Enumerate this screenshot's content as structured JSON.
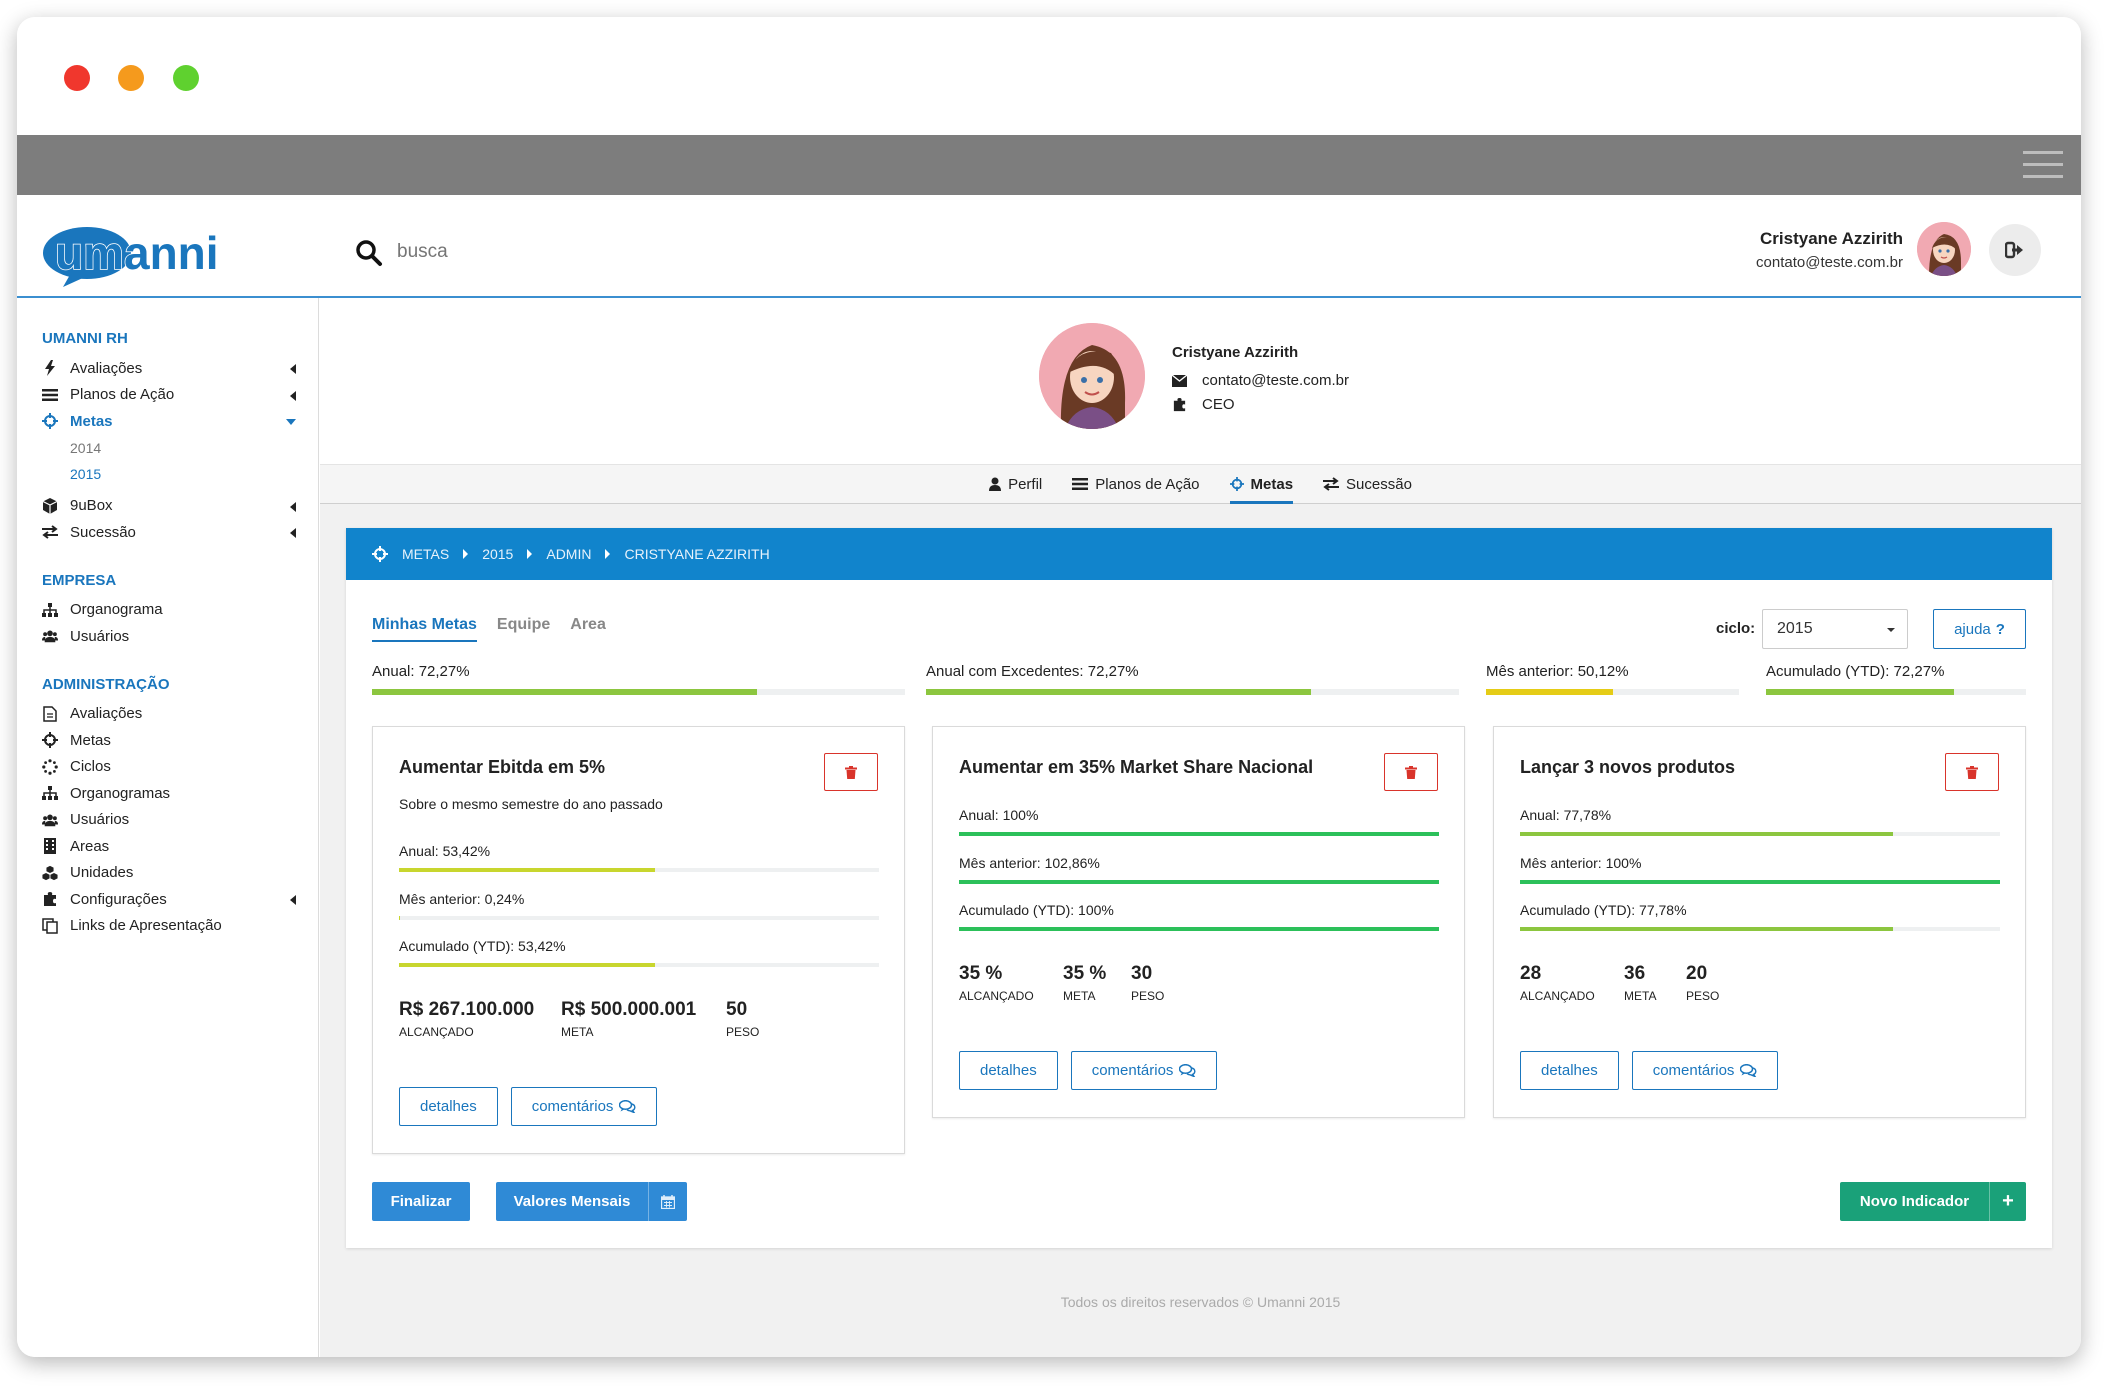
{
  "app": {
    "logo_text": "umanni",
    "search_placeholder": "busca"
  },
  "user": {
    "name": "Cristyane Azzirith",
    "email": "contato@teste.com.br",
    "role": "CEO"
  },
  "sidebar": {
    "sections": [
      {
        "title": "UMANNI RH",
        "items": [
          {
            "label": "Avaliações",
            "icon": "bolt-icon",
            "has_arrow": true
          },
          {
            "label": "Planos de Ação",
            "icon": "list-icon",
            "has_arrow": true
          },
          {
            "label": "Metas",
            "icon": "crosshair-icon",
            "active": true,
            "expanded": true,
            "subitems": [
              {
                "label": "2014"
              },
              {
                "label": "2015",
                "active": true
              }
            ]
          },
          {
            "label": "9uBox",
            "icon": "cube-icon",
            "has_arrow": true
          },
          {
            "label": "Sucessão",
            "icon": "exchange-icon",
            "has_arrow": true
          }
        ]
      },
      {
        "title": "EMPRESA",
        "items": [
          {
            "label": "Organograma",
            "icon": "sitemap-icon"
          },
          {
            "label": "Usuários",
            "icon": "users-icon"
          }
        ]
      },
      {
        "title": "ADMINISTRAÇÃO",
        "items": [
          {
            "label": "Avaliações",
            "icon": "file-icon"
          },
          {
            "label": "Metas",
            "icon": "crosshair-icon"
          },
          {
            "label": "Ciclos",
            "icon": "spinner-icon"
          },
          {
            "label": "Organogramas",
            "icon": "sitemap-icon"
          },
          {
            "label": "Usuários",
            "icon": "users-icon"
          },
          {
            "label": "Areas",
            "icon": "building-icon"
          },
          {
            "label": "Unidades",
            "icon": "cubes-icon"
          },
          {
            "label": "Configurações",
            "icon": "puzzle-icon",
            "has_arrow": true
          },
          {
            "label": "Links de Apresentação",
            "icon": "copy-icon"
          }
        ]
      }
    ]
  },
  "profile_tabs": [
    {
      "label": "Perfil",
      "icon": "user-icon"
    },
    {
      "label": "Planos de Ação",
      "icon": "list-icon"
    },
    {
      "label": "Metas",
      "icon": "crosshair-icon",
      "active": true
    },
    {
      "label": "Sucessão",
      "icon": "exchange-icon"
    }
  ],
  "breadcrumb": [
    "METAS",
    "2015",
    "ADMIN",
    "CRISTYANE AZZIRITH"
  ],
  "subtabs": [
    {
      "label": "Minhas Metas",
      "active": true
    },
    {
      "label": "Equipe"
    },
    {
      "label": "Area"
    }
  ],
  "ciclo": {
    "label": "ciclo:",
    "value": "2015"
  },
  "help_label": "ajuda",
  "summary": [
    {
      "label": "Anual: 72,27%",
      "percent": 72.27,
      "color": "#8cc63f"
    },
    {
      "label": "Anual com Excedentes: 72,27%",
      "percent": 72.27,
      "color": "#8cc63f"
    },
    {
      "label": "Mês anterior: 50,12%",
      "percent": 50.12,
      "color": "#e5cc16"
    },
    {
      "label": "Acumulado (YTD): 72,27%",
      "percent": 72.27,
      "color": "#8cc63f"
    }
  ],
  "cards": [
    {
      "title": "Aumentar Ebitda em 5%",
      "subtitle": "Sobre o mesmo semestre do ano passado",
      "metrics": [
        {
          "label": "Anual: 53,42%",
          "percent": 53.42,
          "color": "#c8d62e"
        },
        {
          "label": "Mês anterior: 0,24%",
          "percent": 0.24,
          "color": "#c8d62e"
        },
        {
          "label": "Acumulado (YTD): 53,42%",
          "percent": 53.42,
          "color": "#c8d62e"
        }
      ],
      "stats": [
        {
          "value": "R$ 267.100.000",
          "caption": "ALCANÇADO"
        },
        {
          "value": "R$ 500.000.001",
          "caption": "META"
        },
        {
          "value": "50",
          "caption": "PESO"
        }
      ],
      "details_label": "detalhes",
      "comments_label": "comentários"
    },
    {
      "title": "Aumentar em 35% Market Share Nacional",
      "subtitle": "",
      "metrics": [
        {
          "label": "Anual: 100%",
          "percent": 100,
          "color": "#2cc05a"
        },
        {
          "label": "Mês anterior: 102,86%",
          "percent": 100,
          "color": "#2cc05a"
        },
        {
          "label": "Acumulado (YTD): 100%",
          "percent": 100,
          "color": "#2cc05a"
        }
      ],
      "stats": [
        {
          "value": "35 %",
          "caption": "ALCANÇADO"
        },
        {
          "value": "35 %",
          "caption": "META"
        },
        {
          "value": "30",
          "caption": "PESO"
        }
      ],
      "details_label": "detalhes",
      "comments_label": "comentários"
    },
    {
      "title": "Lançar 3 novos produtos",
      "subtitle": "",
      "metrics": [
        {
          "label": "Anual: 77,78%",
          "percent": 77.78,
          "color": "#8cc63f"
        },
        {
          "label": "Mês anterior: 100%",
          "percent": 100,
          "color": "#2cc05a"
        },
        {
          "label": "Acumulado (YTD): 77,78%",
          "percent": 77.78,
          "color": "#8cc63f"
        }
      ],
      "stats": [
        {
          "value": "28",
          "caption": "ALCANÇADO"
        },
        {
          "value": "36",
          "caption": "META"
        },
        {
          "value": "20",
          "caption": "PESO"
        }
      ],
      "details_label": "detalhes",
      "comments_label": "comentários"
    }
  ],
  "actions": {
    "finalize_label": "Finalizar",
    "monthly_label": "Valores Mensais",
    "new_indicator_label": "Novo Indicador"
  },
  "footer": "Todos os direitos reservados © Umanni 2015",
  "colors": {
    "brand_blue": "#1a76bd",
    "breadcrumb_bg": "#1184cc",
    "delete_red": "#d9342b",
    "new_green": "#1aa179"
  }
}
